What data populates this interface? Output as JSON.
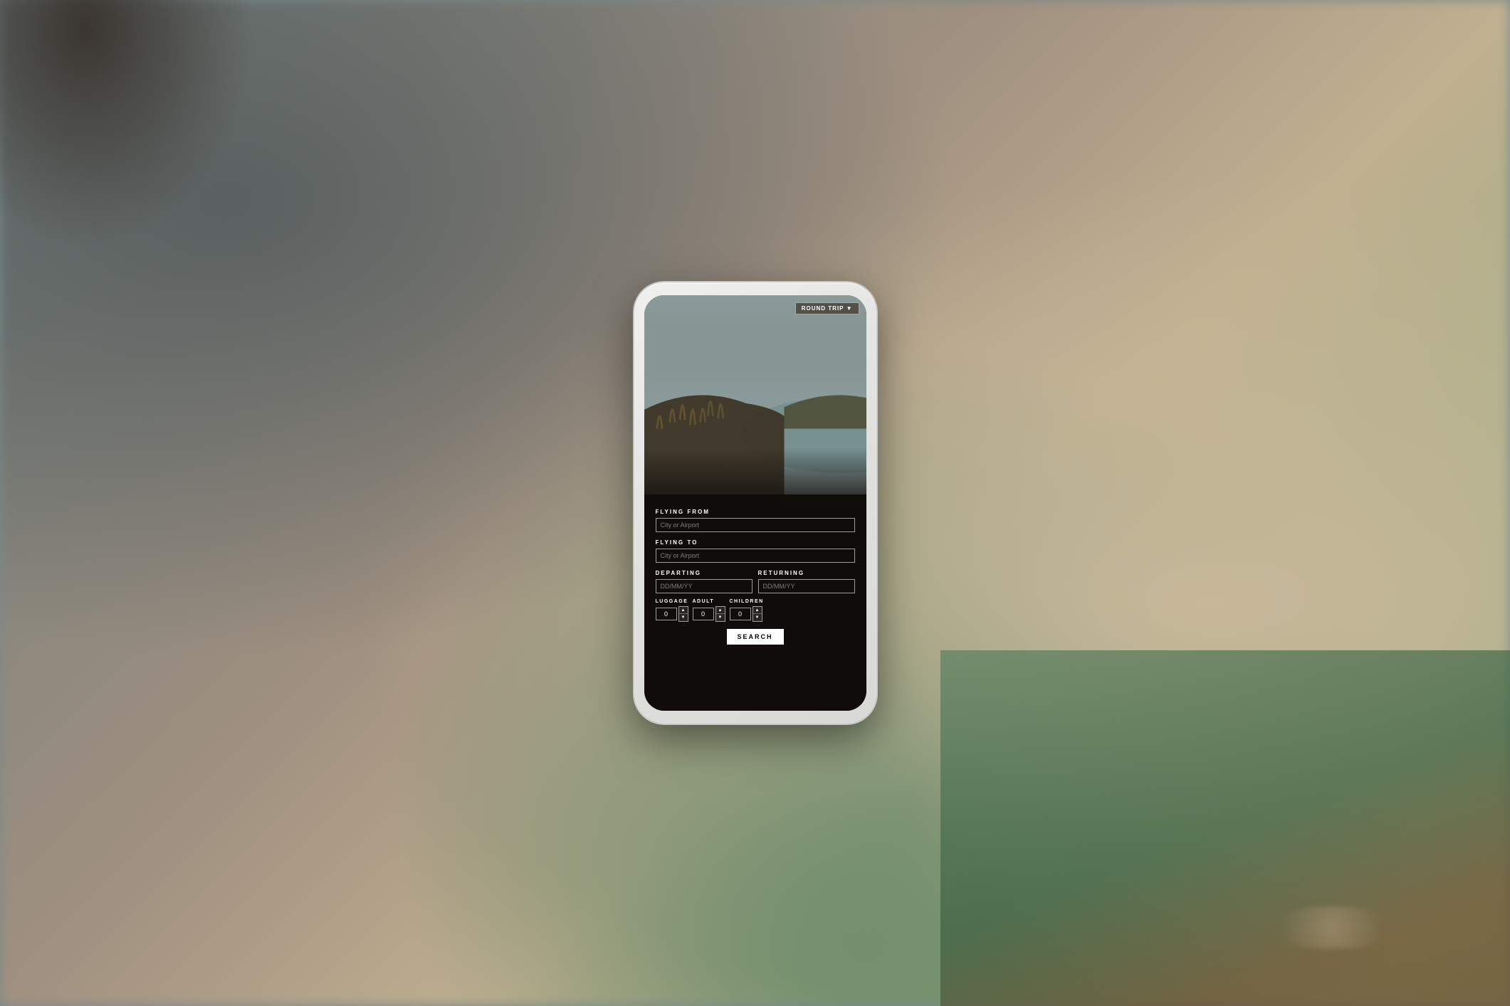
{
  "background": {
    "color": "#7a8a8c"
  },
  "phone": {
    "roundtrip_label": "ROUND TRIP ▼"
  },
  "form": {
    "flying_from_label": "FLYING FROM",
    "flying_from_placeholder": "City or Airport",
    "flying_to_label": "FLYING TO",
    "flying_to_placeholder": "City or Airport",
    "departing_label": "DEPARTING",
    "departing_placeholder": "DD/MM/YY",
    "returning_label": "RETURNING",
    "returning_placeholder": "DD/MM/YY",
    "luggage_label": "LUGGAGE",
    "luggage_value": "0",
    "adult_label": "ADULT",
    "adult_value": "0",
    "children_label": "CHILDREN",
    "children_value": "0",
    "search_label": "SEARCH"
  }
}
